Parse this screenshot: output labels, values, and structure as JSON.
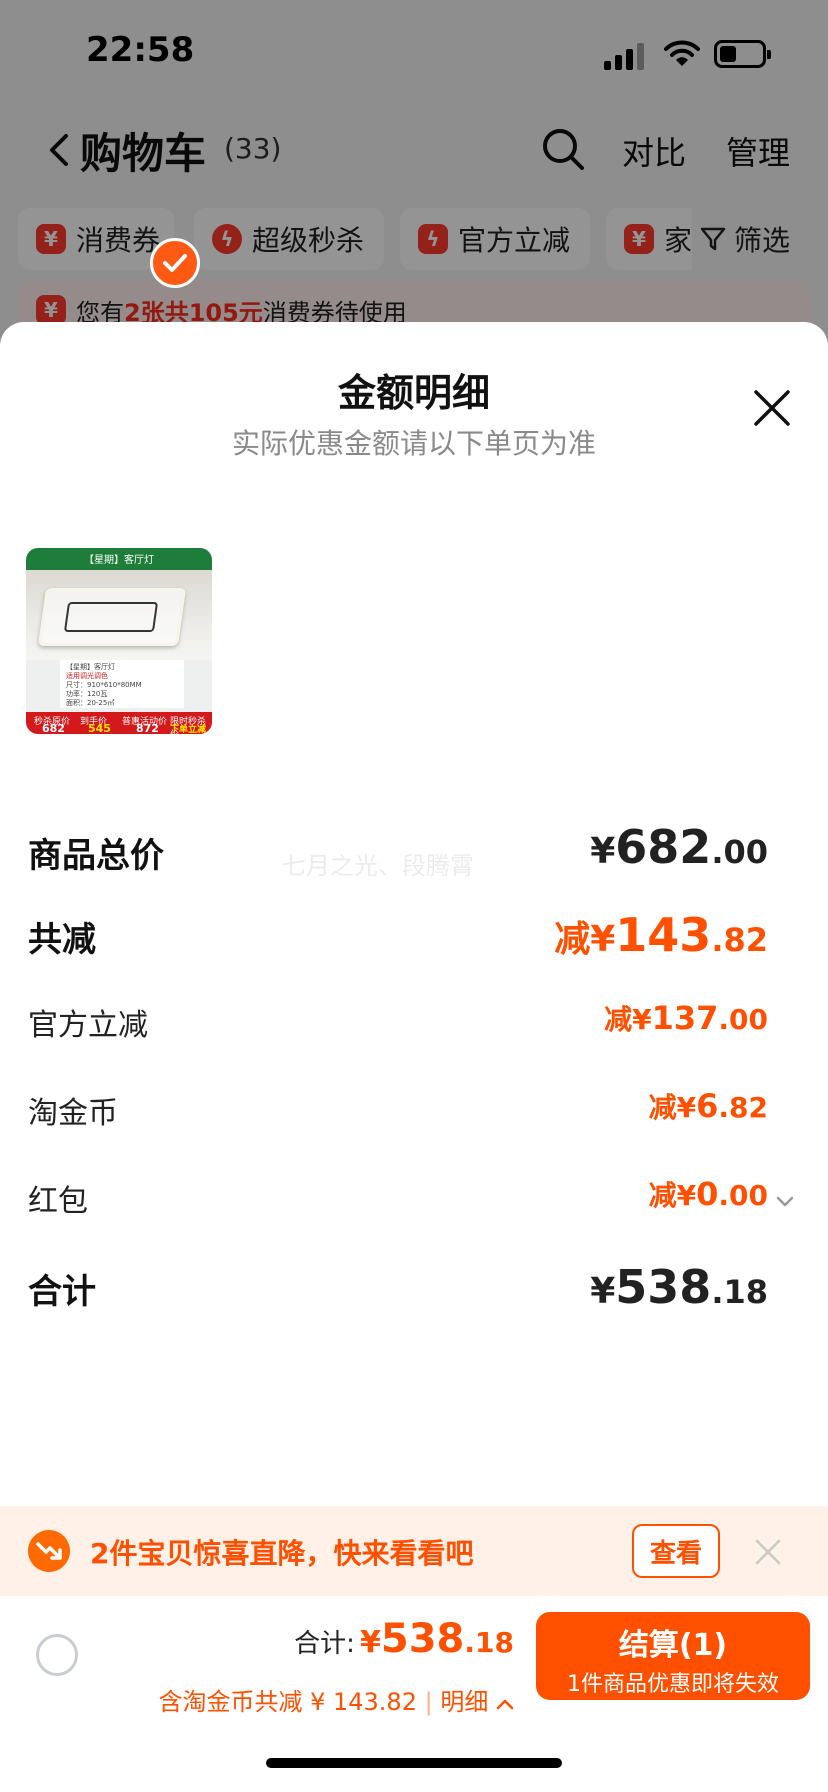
{
  "status_bar": {
    "time": "22:58"
  },
  "nav": {
    "title": "购物车",
    "count": "(33)",
    "compare": "对比",
    "manage": "管理"
  },
  "filters": {
    "chips": [
      {
        "icon": "coupon-icon",
        "label": "消费券"
      },
      {
        "icon": "flash-sale-icon",
        "label": "超级秒杀"
      },
      {
        "icon": "instant-discount-icon",
        "label": "官方立减"
      },
      {
        "icon": "coupon-icon",
        "label": "家"
      }
    ],
    "filter_label": "筛选"
  },
  "notice": {
    "prefix": "您有",
    "highlight": "2张共105元",
    "suffix": "消费券待使用"
  },
  "sheet": {
    "title": "金额明细",
    "subtitle": "实际优惠金额请以下单页为准",
    "thumbnail": {
      "top_band": "【星期】客厅灯",
      "info_lines": [
        "【星期】客厅灯",
        "适用调光调色",
        "尺寸：910*610*80MM",
        "功率：120瓦",
        "面积：20-25㎡"
      ],
      "price_labels": [
        "秒杀原价",
        "到手价",
        "普惠活动价",
        "限时秒杀价"
      ],
      "price_values": [
        "682",
        "545",
        "872",
        "下单立减"
      ]
    },
    "watermark": "七月之光、段腾霄",
    "rows": {
      "total_price": {
        "label": "商品总价",
        "currency": "¥",
        "int": "682",
        "dec": ".00"
      },
      "total_discount": {
        "label": "共减",
        "prefix": "减¥",
        "int": "143",
        "dec": ".82"
      },
      "official_discount": {
        "label": "官方立减",
        "prefix": "减¥",
        "int": "137",
        "dec": ".00"
      },
      "taojin_coins": {
        "label": "淘金币",
        "prefix": "减¥",
        "int": "6",
        "dec": ".82"
      },
      "red_packet": {
        "label": "红包",
        "prefix": "减¥",
        "int": "0",
        "dec": ".00"
      },
      "sum": {
        "label": "合计",
        "currency": "¥",
        "int": "538",
        "dec": ".18"
      }
    }
  },
  "promo": {
    "text": "2件宝贝惊喜直降，快来看看吧",
    "button": "查看"
  },
  "checkout": {
    "total_label": "合计:",
    "currency": "¥",
    "total_int": "538",
    "total_dec": ".18",
    "discount_text": "含淘金币共减 ¥ 143.82",
    "separator": "|",
    "detail_label": "明细",
    "button_main": "结算(1)",
    "button_sub": "1件商品优惠即将失效"
  },
  "colors": {
    "accent": "#ff5000",
    "chip_red": "#ff3b30",
    "promo_bg": "#fff1e8"
  }
}
